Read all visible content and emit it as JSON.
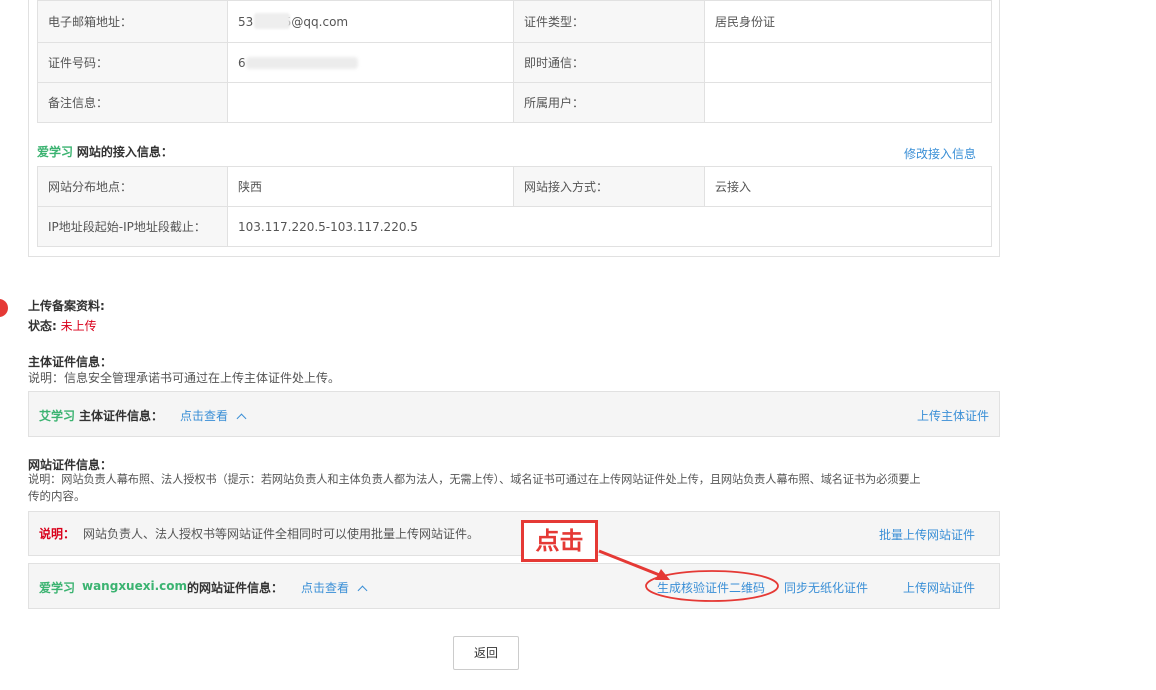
{
  "account_table": {
    "rows": [
      {
        "l1": "电子邮箱地址：",
        "v1": "53      15@qq.com",
        "l2": "证件类型：",
        "v2": "居民身份证"
      },
      {
        "l1": "证件号码：",
        "v1": "6",
        "l2": "即时通信：",
        "v2": ""
      },
      {
        "l1": "备注信息：",
        "v1": "",
        "l2": "所属用户：",
        "v2": ""
      }
    ]
  },
  "access": {
    "site_name": "爱学习",
    "title": "网站的接入信息：",
    "edit_link": "修改接入信息",
    "rows": [
      {
        "l1": "网站分布地点：",
        "v1": "陕西",
        "l2": "网站接入方式：",
        "v2": "云接入"
      },
      {
        "l1": "IP地址段起始-IP地址段截止：",
        "v1": "103.117.220.5-103.117.220.5"
      }
    ]
  },
  "upload": {
    "title": "上传备案资料:",
    "status_label": "状态:",
    "status_value": "未上传"
  },
  "subject_cert": {
    "title": "主体证件信息：",
    "desc": "说明：信息安全管理承诺书可通过在上传主体证件处上传。",
    "site_name": "艾学习",
    "label": "主体证件信息：",
    "view_link": "点击查看",
    "upload_link": "上传主体证件"
  },
  "site_cert": {
    "title": "网站证件信息：",
    "desc_line1": "说明：网站负责人幕布照、法人授权书（提示：若网站负责人和主体负责人都为法人，无需上传）、域名证书可通过在上传网站证件处上传，且网站负责人幕布照、域名证书为必须要上",
    "desc_line2": "传的内容。",
    "note_label": "说明：",
    "note_text": "网站负责人、法人授权书等网站证件全相同时可以使用批量上传网站证件。",
    "batch_link": "批量上传网站证件",
    "site_name": "爱学习",
    "domain": "wangxuexi.com",
    "label": "的网站证件信息：",
    "view_link": "点击查看",
    "qr_link": "生成核验证件二维码",
    "sync_link": "同步无纸化证件",
    "upload_link": "上传网站证件"
  },
  "annotation": {
    "text": "点击"
  },
  "footer": {
    "back_label": "返回"
  },
  "colors": {
    "green": "#3bb371",
    "link": "#3a8fd6",
    "red": "#d9001b",
    "annotation": "#e53935"
  }
}
